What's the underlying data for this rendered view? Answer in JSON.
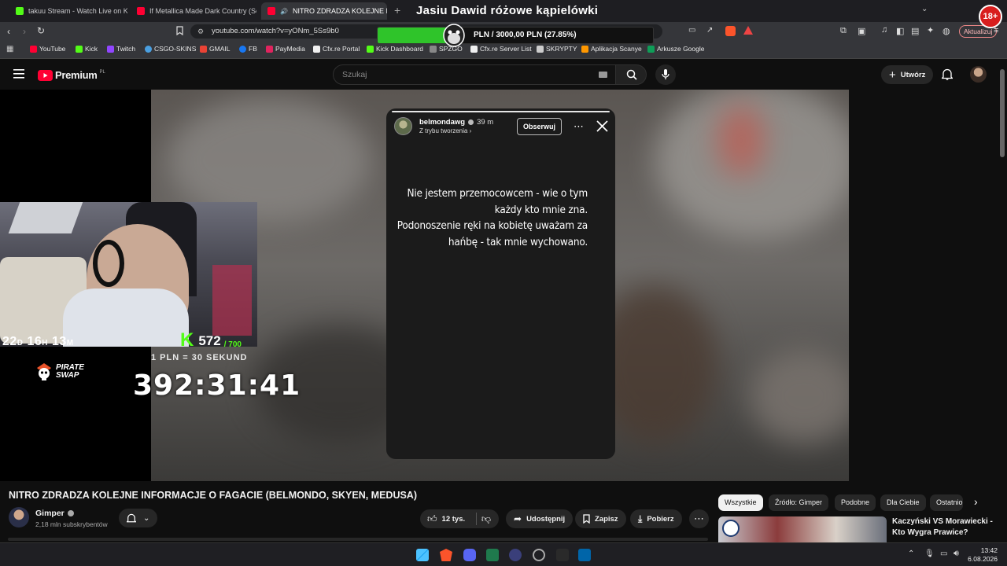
{
  "browser": {
    "tabs": [
      {
        "label": "takuu Stream - Watch Live on Kic",
        "color": "#53fc18"
      },
      {
        "label": "If Metallica Made Dark Country (Sev",
        "color": "#ff0033"
      },
      {
        "label": "NITRO ZDRADZA KOLEJNE INF",
        "color": "#ff0033"
      }
    ],
    "stream_title_overlay": "Jasiu Dawid różowe kąpielówki",
    "url": "youtube.com/watch?v=yONm_5Ss9b0",
    "update_label": "Aktualizuj",
    "bookmarks": [
      {
        "label": "YouTube",
        "color": "#ff0033"
      },
      {
        "label": "Kick",
        "color": "#53fc18"
      },
      {
        "label": "Twitch",
        "color": "#9146ff"
      },
      {
        "label": "CSGO-SKINS",
        "color": "#4a9fe0"
      },
      {
        "label": "GMAIL",
        "color": "#ea4335"
      },
      {
        "label": "FB",
        "color": "#1877f2"
      },
      {
        "label": "PayMedia",
        "color": "#e0245e"
      },
      {
        "label": "Cfx.re Portal",
        "color": "#f0f0f0"
      },
      {
        "label": "Kick Dashboard",
        "color": "#53fc18"
      },
      {
        "label": "SPZGO",
        "color": "#888888"
      },
      {
        "label": "Cfx.re Server List",
        "color": "#f0f0f0"
      },
      {
        "label": "SKRYPTY",
        "color": "#cccccc"
      },
      {
        "label": "Aplikacja Scanye",
        "color": "#ff9800"
      },
      {
        "label": "Arkusze Google",
        "color": "#0f9d58"
      }
    ]
  },
  "donation_goal": {
    "text": "PLN / 3000,00 PLN  (27.85%)",
    "progress": 0.2785
  },
  "age_badge": "18+",
  "youtube": {
    "brand": "Premium",
    "region": "PL",
    "search_placeholder": "Szukaj",
    "create_label": "Utwórz"
  },
  "story": {
    "username": "belmondawg",
    "time": "39 m",
    "subtitle": "Z trybu tworzenia",
    "follow_label": "Obserwuj",
    "lines": [
      "Nie jestem przemocowcem - wie o tym",
      "każdy kto mnie zna.",
      "Podonoszenie ręki na kobietę uważam za",
      "hańbę - tak  mnie wychowano."
    ]
  },
  "stream_overlay": {
    "countdown": "22D 16H 13M",
    "countdown_parts": [
      "22",
      "D",
      "16",
      "H",
      "13",
      "M"
    ],
    "kick_followers": "572",
    "kick_goal": "/ 700",
    "rate": "1 PLN = 30 SEKUND",
    "sponsor": "PIRATE SWAP",
    "sponsor_lines": [
      "PIRATE",
      "SWAP"
    ],
    "timer": "392:31:41"
  },
  "video": {
    "title": "NITRO ZDRADZA KOLEJNE INFORMACJE O FAGACIE (BELMONDO, SKYEN, MEDUSA)",
    "channel": "Gimper",
    "subscribers": "2,18 mln subskrybentów",
    "likes": "12 tys.",
    "share_label": "Udostępnij",
    "save_label": "Zapisz",
    "download_label": "Pobierz"
  },
  "chips": [
    {
      "label": "Wszystkie",
      "selected": true
    },
    {
      "label": "Źródło: Gimper",
      "selected": false
    },
    {
      "label": "Podobne",
      "selected": false
    },
    {
      "label": "Dla Ciebie",
      "selected": false
    },
    {
      "label": "Ostatnio",
      "selected": false
    }
  ],
  "recommendation": {
    "title_lines": [
      "Kaczyński VS Morawiecki -",
      "Kto Wygra Prawice?"
    ]
  },
  "taskbar": {
    "time": "13:42",
    "date": "6.08.2026"
  }
}
